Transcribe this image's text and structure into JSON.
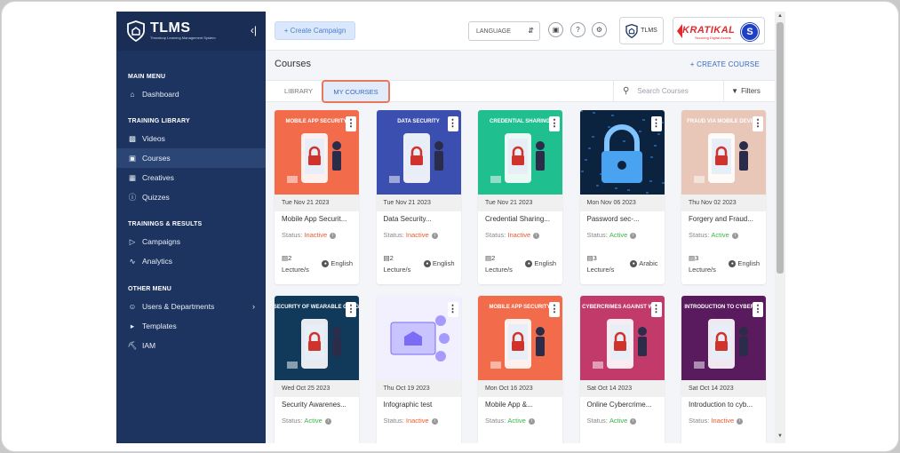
{
  "app": {
    "name": "TLMS",
    "tagline": "Threatcop Learning Management System",
    "collapse_icon": "collapse-icon"
  },
  "sidebar": {
    "sections": [
      {
        "heading": "MAIN MENU",
        "items": [
          {
            "label": "Dashboard",
            "icon": "home-icon"
          }
        ]
      },
      {
        "heading": "TRAINING LIBRARY",
        "items": [
          {
            "label": "Videos",
            "icon": "video-icon"
          },
          {
            "label": "Courses",
            "icon": "book-icon",
            "active": true
          },
          {
            "label": "Creatives",
            "icon": "image-icon"
          },
          {
            "label": "Quizzes",
            "icon": "question-icon"
          }
        ]
      },
      {
        "heading": "TRAININGS & RESULTS",
        "items": [
          {
            "label": "Campaigns",
            "icon": "megaphone-icon"
          },
          {
            "label": "Analytics",
            "icon": "chart-icon"
          }
        ]
      },
      {
        "heading": "OTHER MENU",
        "items": [
          {
            "label": "Users & Departments",
            "icon": "user-icon"
          },
          {
            "label": "Templates",
            "icon": "template-icon"
          },
          {
            "label": "IAM",
            "icon": "key-icon"
          }
        ]
      }
    ]
  },
  "topbar": {
    "create_campaign": "+ Create Campaign",
    "language": "LANGUAGE",
    "tlms_logo_text": "TLMS",
    "client_logo": "KRATIKAL",
    "client_sub": "Securing Digital Assets",
    "avatar_letter": "S"
  },
  "page": {
    "title": "Courses",
    "create_course": "+ CREATE COURSE",
    "tab_library": "LIBRARY",
    "tab_my_courses": "MY COURSES",
    "search_placeholder": "Search Courses",
    "filters": "Filters"
  },
  "cards": [
    {
      "date": "Tue Nov 21 2023",
      "title": "Mobile App Securit...",
      "status_label": "Status:",
      "status": "Inactive",
      "lectures": "2",
      "lecture_unit": "Lecture/s",
      "language": "English",
      "thumb_text": "MOBILE APP SECURITY",
      "bg": "#f26b4b"
    },
    {
      "date": "Tue Nov 21 2023",
      "title": "Data Security...",
      "status_label": "Status:",
      "status": "Inactive",
      "lectures": "2",
      "lecture_unit": "Lecture/s",
      "language": "English",
      "thumb_text": "DATA SECURITY",
      "bg": "#3b4fb0"
    },
    {
      "date": "Tue Nov 21 2023",
      "title": "Credential Sharing...",
      "status_label": "Status:",
      "status": "Inactive",
      "lectures": "2",
      "lecture_unit": "Lecture/s",
      "language": "English",
      "thumb_text": "CREDENTIAL SHARING",
      "bg": "#1fbf8f"
    },
    {
      "date": "Mon Nov 06 2023",
      "title": "Password sec-...",
      "status_label": "Status:",
      "status": "Active",
      "lectures": "3",
      "lecture_unit": "Lecture/s",
      "language": "Arabic",
      "thumb_text": "",
      "bg": "#0c2340"
    },
    {
      "date": "Thu Nov 02 2023",
      "title": "Forgery and Fraud...",
      "status_label": "Status:",
      "status": "Active",
      "lectures": "3",
      "lecture_unit": "Lecture/s",
      "language": "English",
      "thumb_text": "FRAUD VIA MOBILE DEVICE",
      "bg": "#e9c7b8"
    },
    {
      "date": "Wed Oct 25 2023",
      "title": "Security Awarenes...",
      "status_label": "Status:",
      "status": "Active",
      "lectures": "",
      "lecture_unit": "",
      "language": "",
      "thumb_text": "SECURITY OF WEARABLE GADG",
      "bg": "#113a5a"
    },
    {
      "date": "Thu Oct 19 2023",
      "title": "Infographic test",
      "status_label": "Status:",
      "status": "Inactive",
      "lectures": "",
      "lecture_unit": "",
      "language": "",
      "thumb_text": "",
      "bg": "#f2f0ff"
    },
    {
      "date": "Mon Oct 16 2023",
      "title": "Mobile App &...",
      "status_label": "Status:",
      "status": "Active",
      "lectures": "",
      "lecture_unit": "",
      "language": "",
      "thumb_text": "MOBILE APP SECURITY",
      "bg": "#f26b4b"
    },
    {
      "date": "Sat Oct 14 2023",
      "title": "Online Cybercrime...",
      "status_label": "Status:",
      "status": "Active",
      "lectures": "",
      "lecture_unit": "",
      "language": "",
      "thumb_text": "CYBERCRIMES AGAINST WOM",
      "bg": "#c23a6a"
    },
    {
      "date": "Sat Oct 14 2023",
      "title": "Introduction to cyb...",
      "status_label": "Status:",
      "status": "Inactive",
      "lectures": "",
      "lecture_unit": "",
      "language": "",
      "thumb_text": "INTRODUCTION TO CYBERCR",
      "bg": "#5a1a5e"
    }
  ],
  "colors": {
    "active": "#3cb54a",
    "inactive": "#f0582a",
    "sidebar": "#1d3461"
  }
}
